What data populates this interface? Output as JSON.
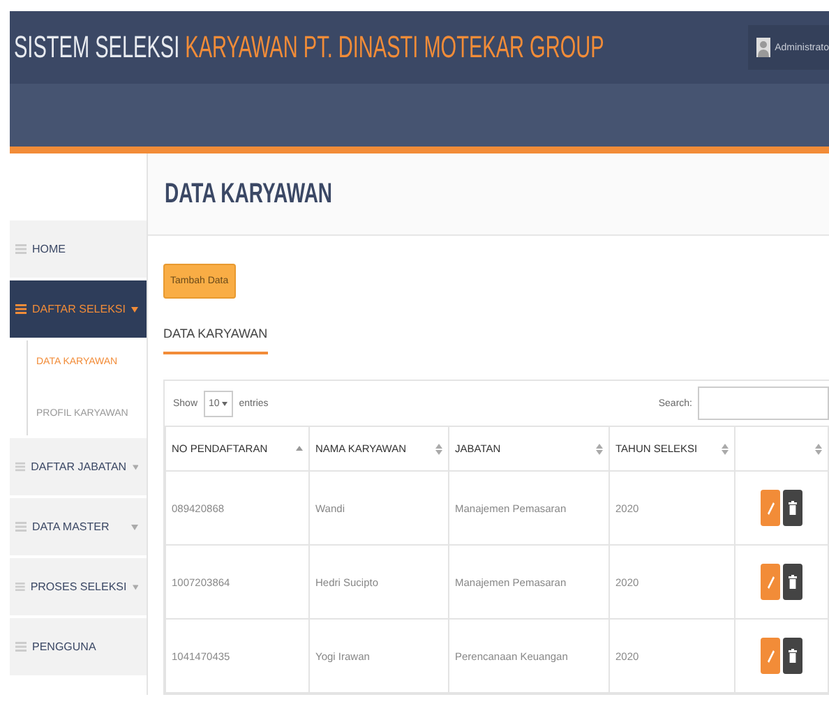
{
  "header": {
    "title_light": "SISTEM SELEKSI",
    "title_accent": "KARYAWAN PT. DINASTI MOTEKAR GROUP",
    "user": "Administrato"
  },
  "sidebar": {
    "items": [
      {
        "label": "HOME",
        "selected": false,
        "expandable": false
      },
      {
        "label": "DAFTAR SELEKSI",
        "selected": true,
        "expandable": true,
        "children": [
          {
            "label": "DATA KARYAWAN",
            "selected": true
          },
          {
            "label": "PROFIL KARYAWAN",
            "selected": false
          }
        ]
      },
      {
        "label": "DAFTAR JABATAN",
        "selected": false,
        "expandable": true
      },
      {
        "label": "DATA MASTER",
        "selected": false,
        "expandable": true
      },
      {
        "label": "PROSES SELEKSI",
        "selected": false,
        "expandable": true
      },
      {
        "label": "PENGGUNA",
        "selected": false,
        "expandable": false
      }
    ]
  },
  "page_title": "DATA KARYAWAN",
  "add_button": "Tambah Data",
  "section_tab": "DATA KARYAWAN",
  "table": {
    "show_label": "Show",
    "page_size": "10",
    "entries_label": "entries",
    "search_label": "Search:",
    "columns": [
      {
        "label": "NO PENDAFTARAN",
        "sorted": true
      },
      {
        "label": "NAMA KARYAWAN",
        "sorted": false
      },
      {
        "label": "JABATAN",
        "sorted": false
      },
      {
        "label": "TAHUN SELEKSI",
        "sorted": false
      },
      {
        "sorted": false
      }
    ],
    "rows": [
      {
        "no": "089420868",
        "nama": "Wandi",
        "jabatan": "Manajemen Pemasaran",
        "tahun": "2020"
      },
      {
        "no": "1007203864",
        "nama": "Hedri Sucipto",
        "jabatan": "Manajemen Pemasaran",
        "tahun": "2020"
      },
      {
        "no": "1041470435",
        "nama": "Yogi Irawan",
        "jabatan": "Perencanaan Keuangan",
        "tahun": "2020"
      }
    ]
  }
}
